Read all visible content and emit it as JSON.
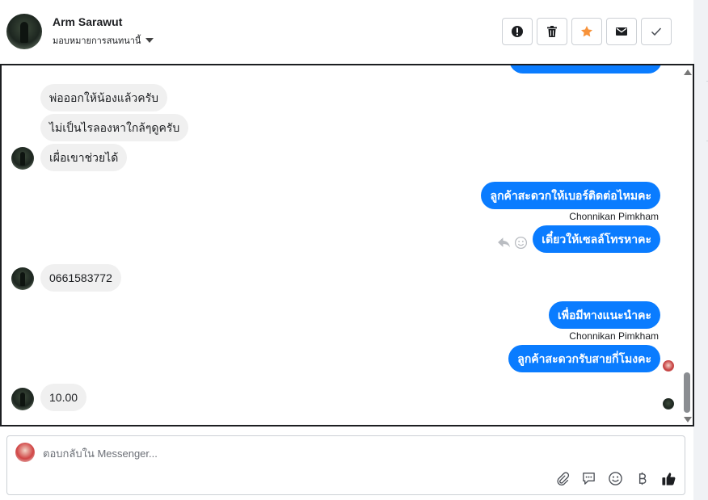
{
  "header": {
    "contact_name": "Arm Sarawut",
    "assign_label": "มอบหมายการสนทนานี้",
    "actions": [
      {
        "name": "spam-button",
        "icon": "exclamation-icon"
      },
      {
        "name": "delete-button",
        "icon": "trash-icon"
      },
      {
        "name": "follow-up-button",
        "icon": "star-icon",
        "color": "#f7923a"
      },
      {
        "name": "mark-unread-button",
        "icon": "envelope-icon"
      },
      {
        "name": "mark-done-button",
        "icon": "check-icon"
      }
    ]
  },
  "messages": {
    "in_1": "พ่อออกให้น้องแล้วครับ",
    "in_2": "ไม่เป็นไรลองหาใกล้ๆดูครับ",
    "in_3": "เผื่อเขาช่วยได้",
    "out_1": "ลูกค้าสะดวกให้เบอร์ติดต่อไหมคะ",
    "sender_1": "Chonnikan Pimkham",
    "out_2": "เดี๋ยวให้เซลล์โทรหาคะ",
    "in_4": "0661583772",
    "out_3": "เพื่อมีทางแนะนำคะ",
    "sender_2": "Chonnikan Pimkham",
    "out_4": "ลูกค้าสะดวกรับสายกี่โมงคะ",
    "in_5": "10.00"
  },
  "composer": {
    "placeholder": "ตอบกลับใน Messenger...",
    "tools": [
      "paperclip-icon",
      "saved-reply-icon",
      "emoji-icon",
      "baht-icon",
      "thumbs-up-icon"
    ]
  },
  "colors": {
    "outgoing_bubble": "#0a7cff",
    "incoming_bubble": "#f0f0f0",
    "star": "#f7923a"
  }
}
